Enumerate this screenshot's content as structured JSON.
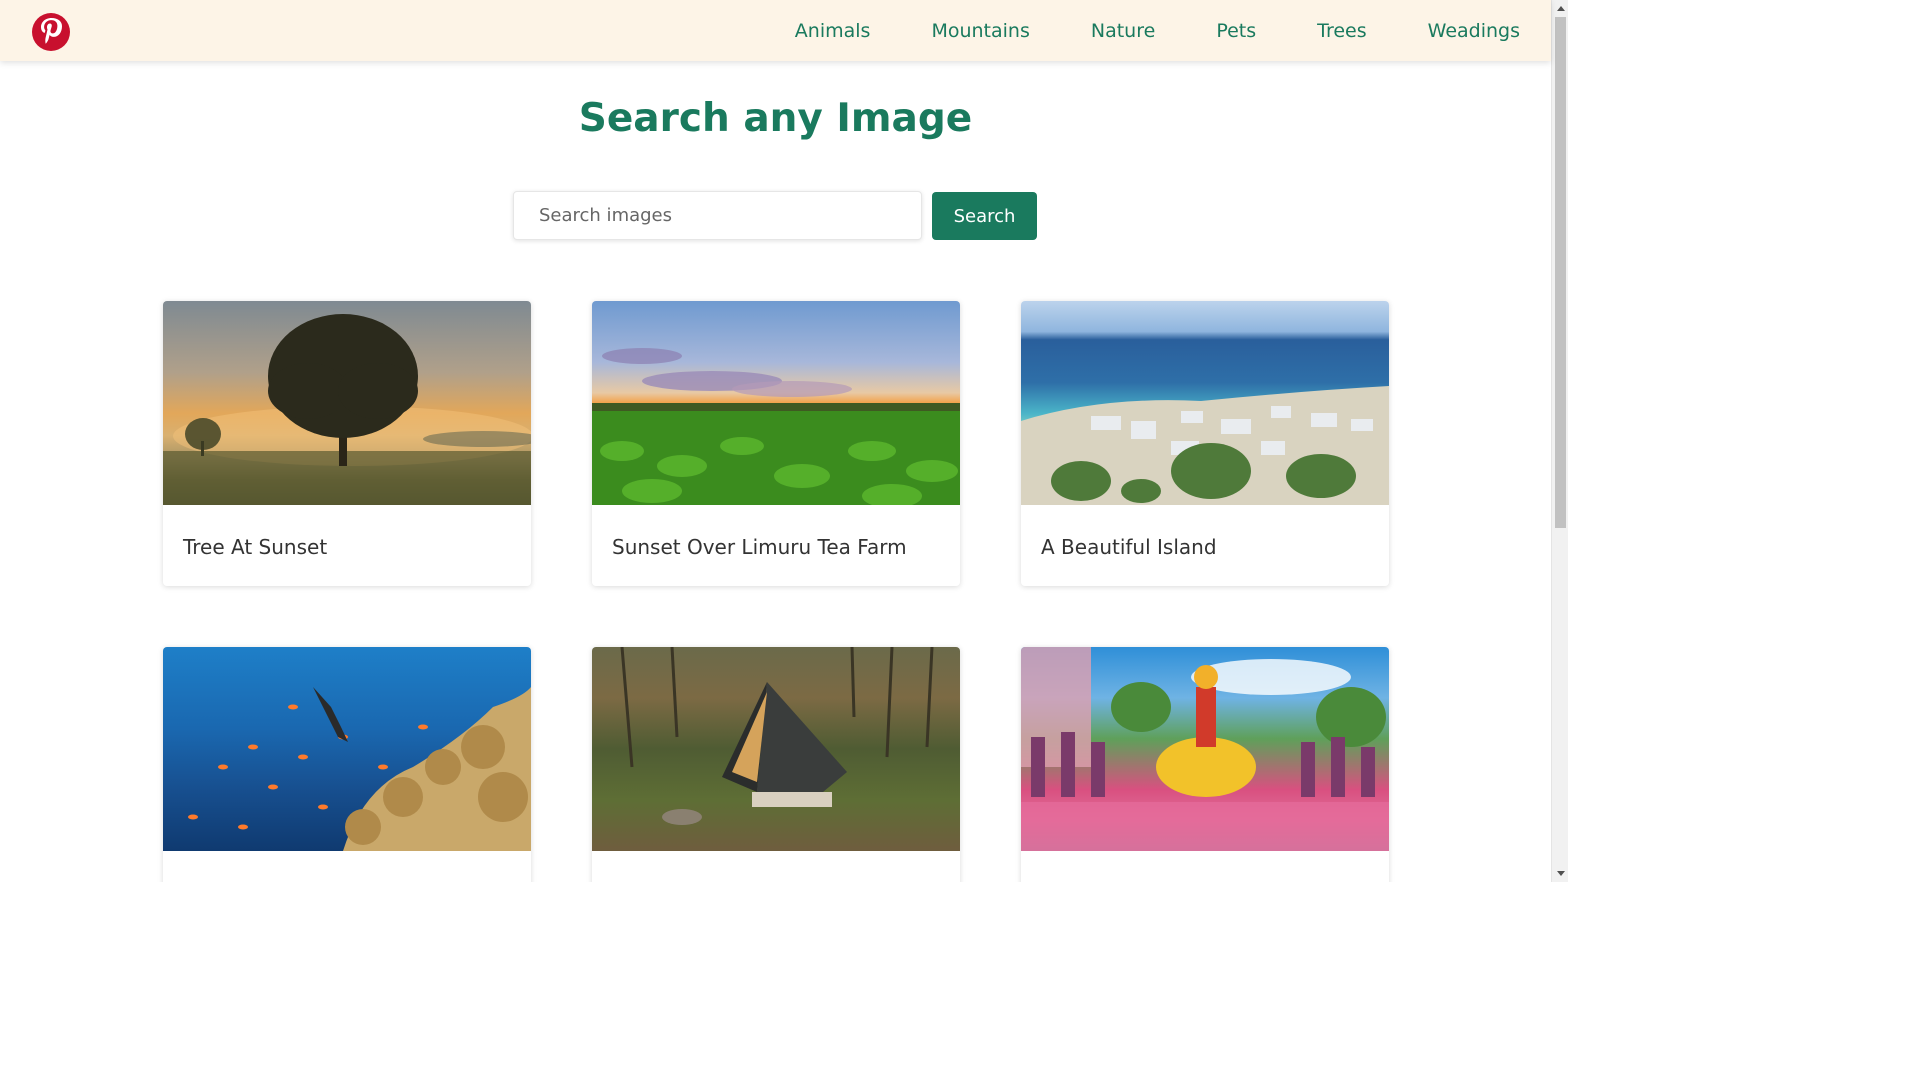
{
  "nav": {
    "logo_name": "pinterest-logo",
    "links": [
      {
        "label": "Animals"
      },
      {
        "label": "Mountains"
      },
      {
        "label": "Nature"
      },
      {
        "label": "Pets"
      },
      {
        "label": "Trees"
      },
      {
        "label": "Weadings"
      }
    ]
  },
  "main": {
    "title": "Search any Image",
    "search": {
      "placeholder": "Search images",
      "value": "",
      "button_label": "Search"
    },
    "cards": [
      {
        "title": "Tree At Sunset"
      },
      {
        "title": "Sunset Over Limuru Tea Farm"
      },
      {
        "title": "A Beautiful Island"
      },
      {
        "title": ""
      },
      {
        "title": ""
      },
      {
        "title": ""
      }
    ]
  },
  "colors": {
    "accent": "#1a7a5e",
    "nav_background": "#fdf4e7",
    "logo_red": "#c8102e"
  }
}
